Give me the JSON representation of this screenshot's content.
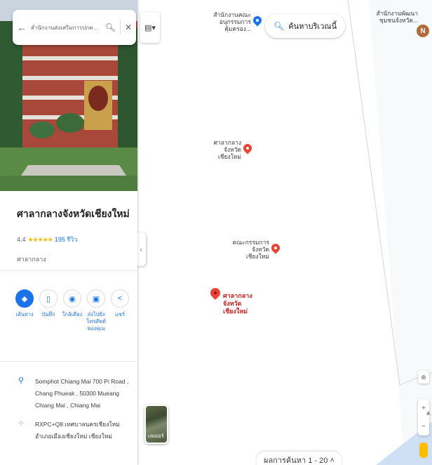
{
  "search": {
    "query": "สำนักงานส่งเสริมการปกครองท้องถิ่น"
  },
  "place": {
    "title": "ศาลากลางจังหวัดเชียงใหม่",
    "rating": "4.4",
    "stars": "★★★★★",
    "reviews": "195 รีวิว",
    "category": "ศาลากลาง"
  },
  "actions": [
    {
      "label": "เส้นทาง",
      "icon": "directions-icon"
    },
    {
      "label": "บันทึก",
      "icon": "bookmark-icon"
    },
    {
      "label": "ใกล้เคียง",
      "icon": "nearby-icon"
    },
    {
      "label": "ส่งไปยังโทรศัพท์ของคุณ",
      "icon": "send-to-phone-icon"
    },
    {
      "label": "แชร์",
      "icon": "share-icon"
    }
  ],
  "info": {
    "address": "Somphot Chiang Mai 700 Pi Road , Chang Phueak , 50300 Mueang Chiang Mai , Chiang Mai",
    "plus_code": "RXPC+Q8 เทศบาลนครเชียงใหม่ อำเภอเมืองเชียงใหม่ เชียงใหม่"
  },
  "map": {
    "search_area_label": "ค้นหาบริเวณนี้",
    "main_pin_label": "ศาลากลางจังหวัดเชียงใหม่",
    "pois": [
      {
        "name": "สำนักงานคณะอนุกรรมการคุ้มครอง...",
        "color": "#1a73e8"
      },
      {
        "name": "ศาลากลางจังหวัดเชียงใหม่",
        "color": "#ea4335"
      },
      {
        "name": "คณะกรรมการจังหวัดเชียงใหม่",
        "color": "#ea4335"
      },
      {
        "name": "สำนักงานพัฒนาชุมชนจังหวัด...",
        "color": "#1a73e8"
      }
    ],
    "profile_initial": "N",
    "layers_label": "เลเยอร์",
    "results_label": "ผลการค้นหา 1 - 20 ˄",
    "edge_label": "ส..."
  }
}
